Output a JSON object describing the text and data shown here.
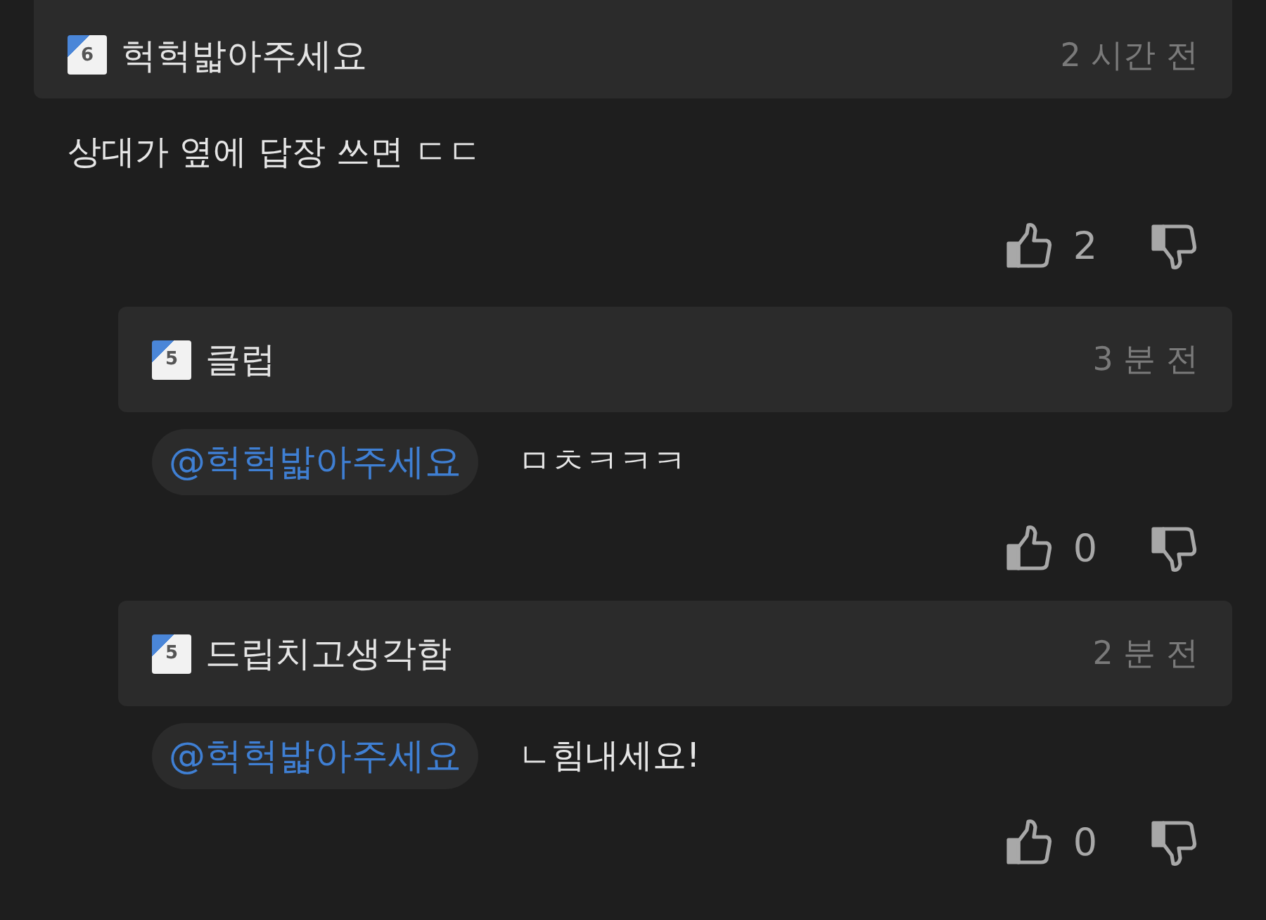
{
  "comments": [
    {
      "author": "헉헉밟아주세요",
      "level_badge": "6",
      "time": "2 시간 전",
      "text": "상대가 옆에 답장 쓰면 ㄷㄷ",
      "likes": "2",
      "replies": [
        {
          "author": "클럽",
          "level_badge": "5",
          "time": "3 분 전",
          "mention": "@헉헉밟아주세요",
          "text": "ㅁㅊㅋㅋㅋ",
          "likes": "0"
        },
        {
          "author": "드립치고생각함",
          "level_badge": "5",
          "time": "2 분 전",
          "mention": "@헉헉밟아주세요",
          "text": "ㄴ힘내세요!",
          "likes": "0"
        }
      ]
    }
  ]
}
